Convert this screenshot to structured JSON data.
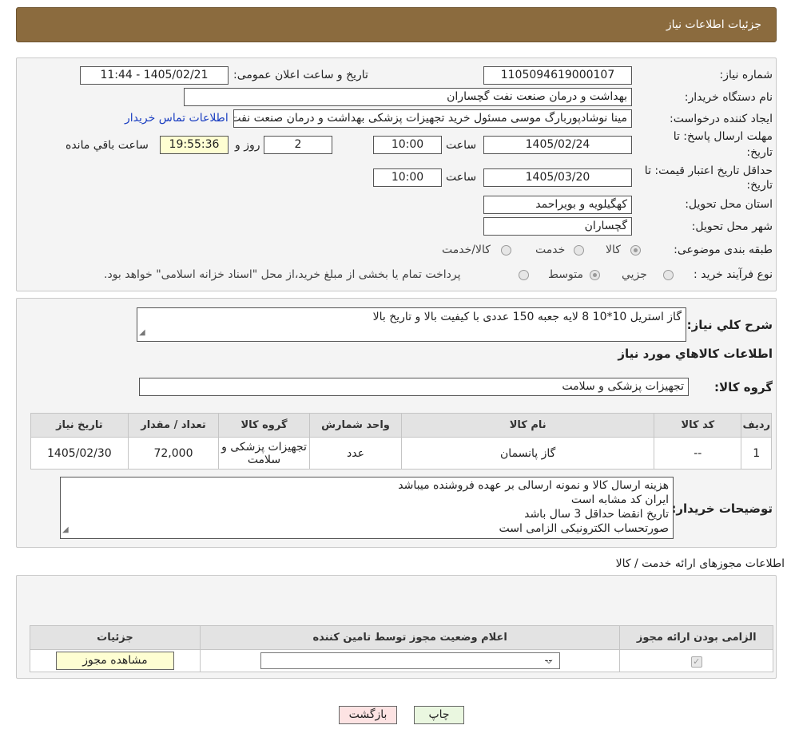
{
  "header": {
    "title": "جزئیات اطلاعات نیاز"
  },
  "form": {
    "need_number_label": "شماره نیاز:",
    "need_number": "1105094619000107",
    "announce_label": "تاریخ و ساعت اعلان عمومی:",
    "announce_value": "1405/02/21 - 11:44",
    "buyer_label": "نام دستگاه خریدار:",
    "buyer_value": "بهداشت و درمان صنعت نفت گچساران",
    "creator_label": "ایجاد کننده درخواست:",
    "creator_value": "مینا نوشادپوربارگ موسی مسئول خرید تجهیزات پزشکی  بهداشت و درمان صنعت نفت",
    "contact_link": "اطلاعات تماس خریدار",
    "deadline_label_1": "مهلت ارسال پاسخ: تا",
    "deadline_label_2": "تاریخ:",
    "deadline_date": "1405/02/24",
    "time_label": "ساعت",
    "deadline_time": "10:00",
    "days_value": "2",
    "days_label": "روز و",
    "remaining_time": "19:55:36",
    "remaining_label": "ساعت باقي مانده",
    "validity_label_1": "حداقل تاریخ اعتبار قیمت: تا",
    "validity_label_2": "تاریخ:",
    "validity_date": "1405/03/20",
    "validity_time": "10:00",
    "province_label": "استان محل تحویل:",
    "province_value": "کهگیلویه و بویراحمد",
    "city_label": "شهر محل تحویل:",
    "city_value": "گچساران",
    "category_label": "طبقه بندی موضوعی:",
    "category_options": [
      "کالا",
      "خدمت",
      "کالا/خدمت"
    ],
    "purchase_type_label": "نوع فرآیند خرید :",
    "purchase_type_options": [
      "جزيي",
      "متوسط"
    ],
    "purchase_note": "پرداخت تمام یا بخشی از مبلغ خرید،از محل \"اسناد خزانه اسلامی\" خواهد بود."
  },
  "details": {
    "summary_label": "شرح کلي نياز:",
    "summary_value": "گاز استریل 10*10 8 لایه جعبه 150 عددی با کیفیت بالا و تاریخ بالا",
    "goods_info_title": "اطلاعات کالاهاي مورد نياز",
    "goods_group_label": "گروه کالا:",
    "goods_group_value": "تجهیزات پزشکی و سلامت",
    "table": {
      "headers": [
        "ردیف",
        "کد کالا",
        "نام کالا",
        "واحد شمارش",
        "گروه کالا",
        "تعداد / مقدار",
        "تاریخ نیاز"
      ],
      "rows": [
        [
          "1",
          "--",
          "گاز پانسمان",
          "عدد",
          "تجهیزات پزشکی و سلامت",
          "72,000",
          "1405/02/30"
        ]
      ]
    },
    "buyer_notes_label": "توضیحات خریدار:",
    "buyer_notes": [
      "هزینه ارسال کالا و نمونه ارسالی بر عهده فروشنده میباشد",
      "ایران کد مشابه است",
      "تاریخ انقضا حداقل 3 سال باشد",
      "صورتحساب الکترونیکی الزامی است"
    ]
  },
  "permits": {
    "title": "اطلاعات مجوزهای ارائه خدمت / کالا",
    "headers": [
      "الزامی بودن ارائه مجوز",
      "اعلام وضعیت مجوز توسط تامین کننده",
      "جزئیات"
    ],
    "select_value": "--",
    "view_button": "مشاهده مجوز"
  },
  "buttons": {
    "print": "چاپ",
    "back": "بازگشت"
  },
  "colors": {
    "header": "#8b6b3e",
    "yellow_field": "#fefed2",
    "link": "#1a3ec1",
    "back_button": "#fde3e3",
    "print_button": "#eaf7e0"
  }
}
